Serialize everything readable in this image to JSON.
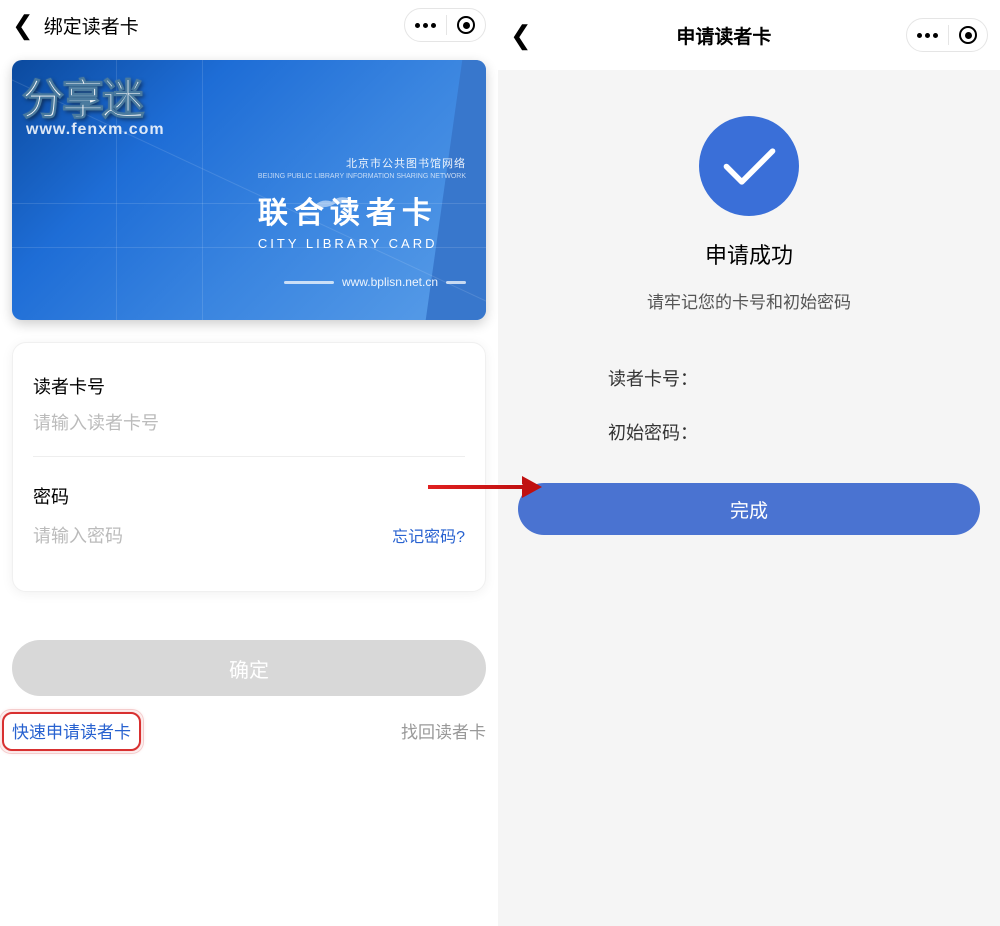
{
  "left": {
    "header": {
      "title": "绑定读者卡"
    },
    "card": {
      "watermark_main": "分享迷",
      "watermark_sub": "www.fenxm.com",
      "org_line": "北京市公共图书馆网络",
      "org_sub": "BEIJING PUBLIC LIBRARY INFORMATION SHARING NETWORK",
      "title_cn": "联合读者卡",
      "title_en": "CITY LIBRARY CARD",
      "url": "www.bplisn.net.cn"
    },
    "form": {
      "card_label": "读者卡号",
      "card_placeholder": "请输入读者卡号",
      "pwd_label": "密码",
      "pwd_placeholder": "请输入密码",
      "forgot": "忘记密码?"
    },
    "confirm": "确定",
    "links": {
      "apply": "快速申请读者卡",
      "find": "找回读者卡"
    }
  },
  "right": {
    "header": {
      "title": "申请读者卡"
    },
    "success": {
      "title": "申请成功",
      "subtitle": "请牢记您的卡号和初始密码",
      "card_label": "读者卡号：",
      "pwd_label_init": "初始密码："
    },
    "done": "完成"
  }
}
